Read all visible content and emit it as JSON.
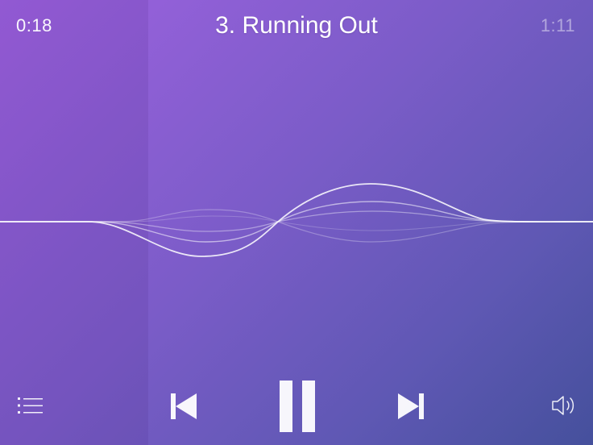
{
  "player": {
    "elapsed": "0:18",
    "total": "1:11",
    "title": "3. Running Out",
    "progress_fraction": 0.25,
    "colors": {
      "gradient_start": "#9e62e0",
      "gradient_end": "#45509c",
      "waveform": "#ffffff"
    }
  },
  "controls": {
    "playlist_icon": "list-icon",
    "previous_icon": "skip-back-icon",
    "pause_icon": "pause-icon",
    "next_icon": "skip-forward-icon",
    "volume_icon": "speaker-icon"
  }
}
